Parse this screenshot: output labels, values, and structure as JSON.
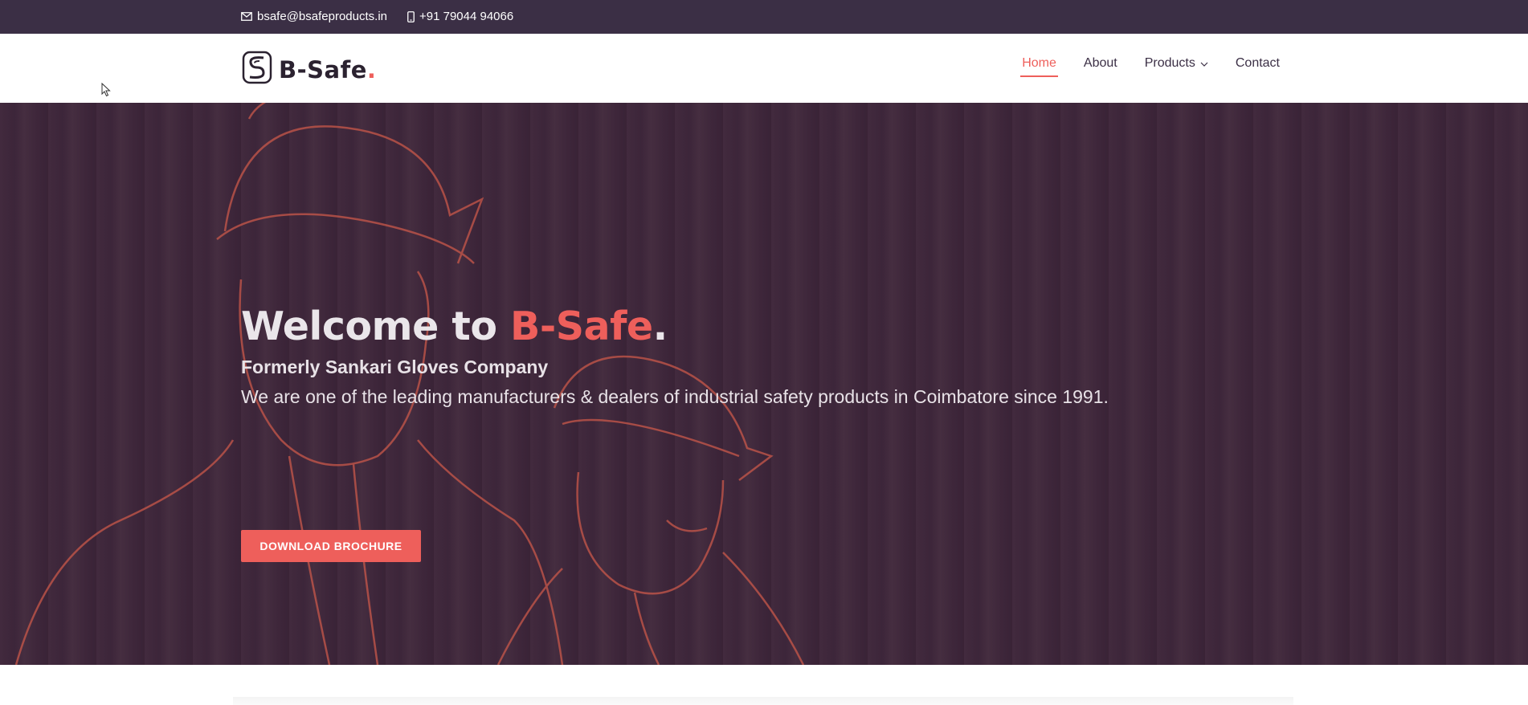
{
  "topbar": {
    "email": "bsafe@bsafeproducts.in",
    "phone": "+91 79044 94066",
    "email_icon": "envelope-icon",
    "phone_icon": "phone-icon"
  },
  "header": {
    "logo_text": "B-Safe",
    "logo_dot": ".",
    "nav": {
      "home": "Home",
      "about": "About",
      "products": "Products",
      "contact": "Contact"
    }
  },
  "hero": {
    "title_prefix": "Welcome to ",
    "title_accent": "B-Safe",
    "title_dot": ".",
    "subtitle": "Formerly Sankari Gloves Company",
    "description": "We are one of the leading manufacturers & dealers of industrial safety products in Coimbatore since 1991.",
    "button_label": "DOWNLOAD BROCHURE"
  },
  "colors": {
    "accent": "#ee5f5b",
    "topbar_bg": "#3b2f45",
    "hero_overlay": "#3c2238"
  }
}
